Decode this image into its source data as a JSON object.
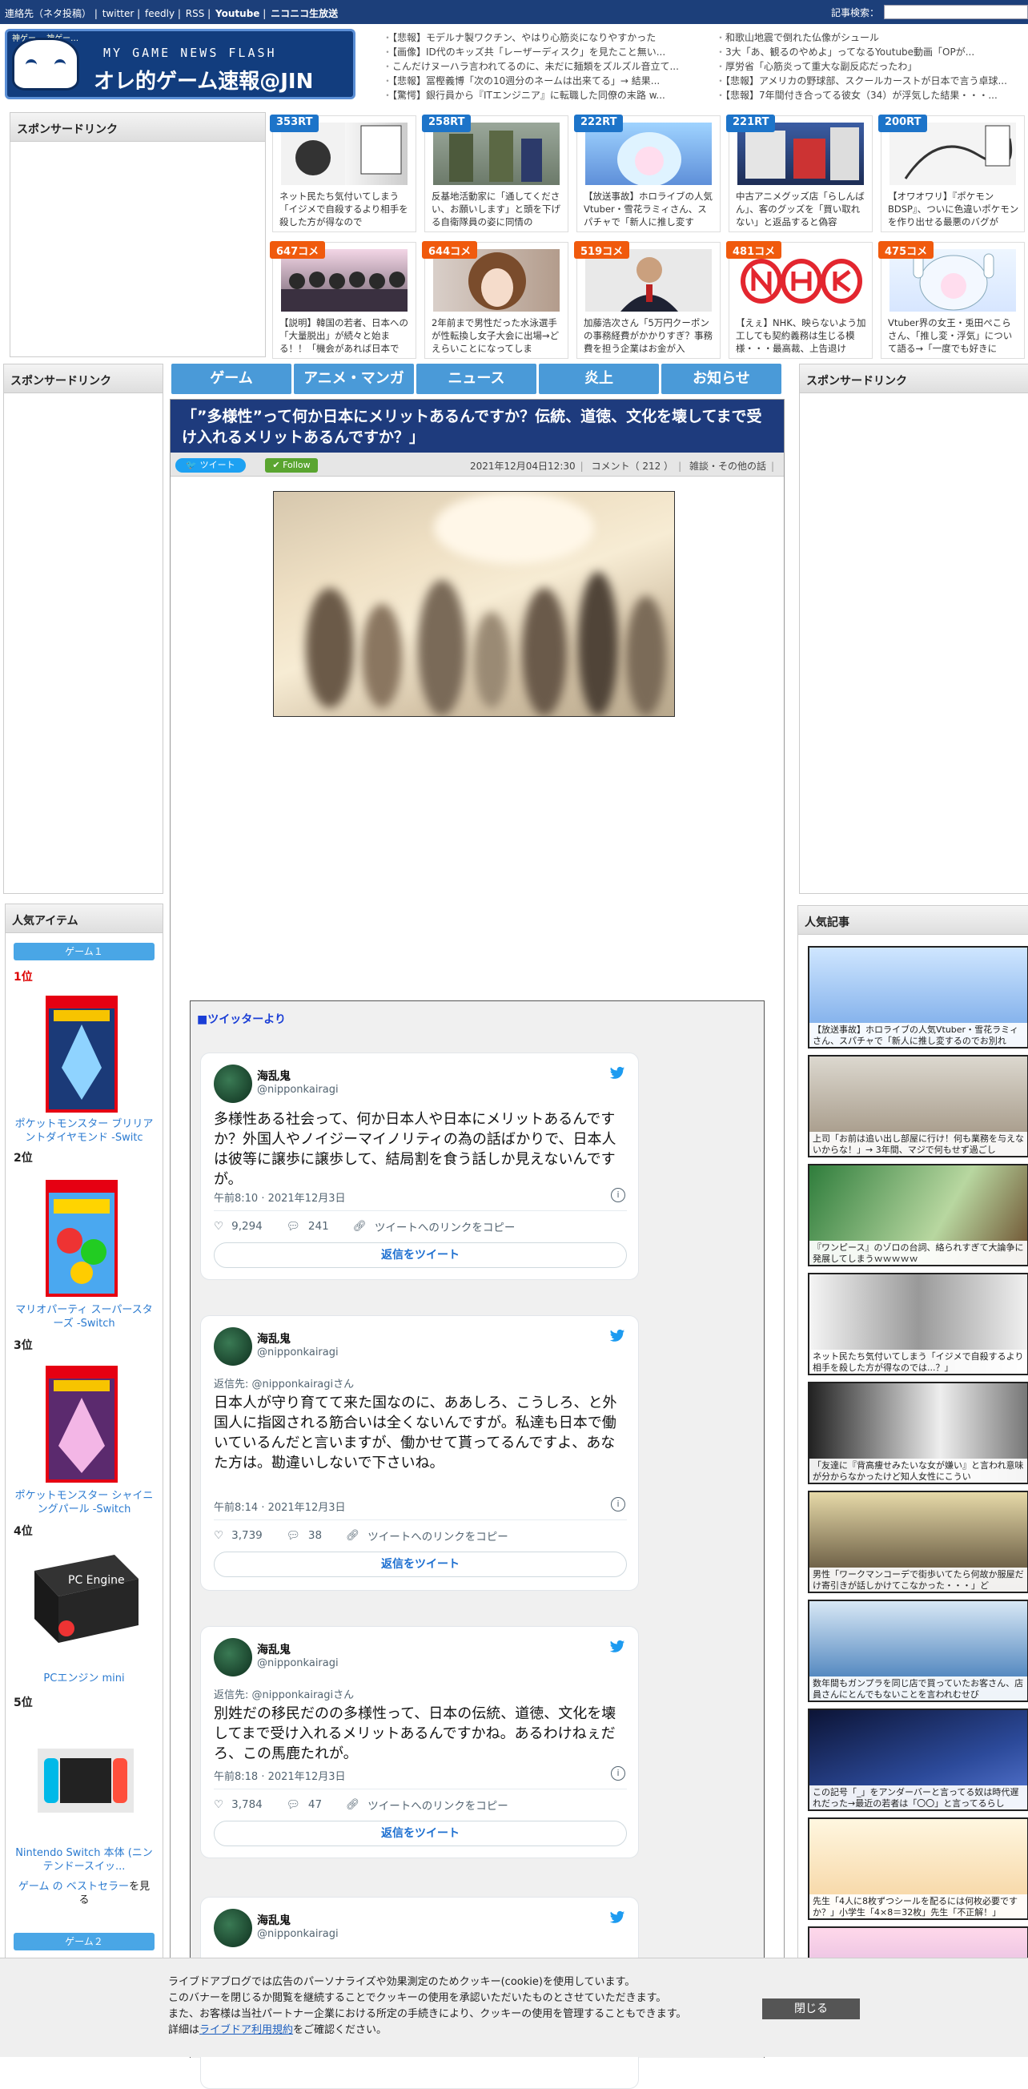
{
  "topbar": {
    "links": [
      "連絡先（ネタ投稿）",
      "twitter",
      "feedly",
      "RSS",
      "Youtube",
      "ニコニコ生放送"
    ],
    "search_label": "記事検索：",
    "search_value": ""
  },
  "logo": {
    "caption": "神ゲー… 神ゲー…",
    "sub": "MY GAME NEWS FLASH",
    "main": "オレ的ゲーム速報@JIN"
  },
  "headlines_left": [
    "【悲報】モデルナ製ワクチン、やはり心筋炎になりやすかった",
    "【画像】ID代のキッズ共「レーザーディスク」を見たこと無い...",
    "こんだけヌーハラ言われてるのに、未だに麺類をズルズル音立て...",
    "【悲報】冨樫義博「次の10週分のネームは出来てる」→ 結果...",
    "【驚愕】銀行員から『ITエンジニア』に転職した同僚の末路 w..."
  ],
  "headlines_right": [
    "和歌山地震で倒れた仏像がシュール",
    "3大「あ、観るのやめよ」ってなるYoutube動画「OPが...",
    "厚労省「心筋炎って重大な副反応だったわ」",
    "【悲報】アメリカの野球部、スクールカーストが日本で言う卓球...",
    "【悲報】7年間付き合ってる彼女（34）が浮気した結果・・・..."
  ],
  "sponsor_label": "スポンサードリンク",
  "trending": [
    {
      "badge": "353RT",
      "kind": "rt",
      "text": "ネット民たち気付いてしまう「イジメで自殺するより相手を殺した方が得なので"
    },
    {
      "badge": "258RT",
      "kind": "rt",
      "text": "反基地活動家に「通してください、お願いします」と頭を下げる自衛隊員の姿に同情の"
    },
    {
      "badge": "222RT",
      "kind": "rt",
      "text": "【放送事故】ホロライブの人気Vtuber・雪花ラミィさん、スパチャで「新人に推し変す"
    },
    {
      "badge": "221RT",
      "kind": "rt",
      "text": "中古アニメグッズ店「らしんばん」、客のグッズを「買い取れない」と返品すると偽容"
    },
    {
      "badge": "200RT",
      "kind": "rt",
      "text": "【オワオワリ】『ポケモンBDSP』、ついに色違いポケモンを作り出せる最悪のバグが"
    },
    {
      "badge": "647コメ",
      "kind": "co",
      "text": "【説明】韓国の若者、日本への「大量脱出」が続々と始まる！！「機会があれば日本で"
    },
    {
      "badge": "644コメ",
      "kind": "co",
      "text": "2年前まで男性だった水泳選手が性転換し女子大会に出場→どえらいことになってしま"
    },
    {
      "badge": "519コメ",
      "kind": "co",
      "text": "加藤浩次さん「5万円クーポンの事務経費がかかりすぎ？事務費を担う企業はお金が入"
    },
    {
      "badge": "481コメ",
      "kind": "co",
      "text": "【えぇ】NHK、映らないよう加工しても契約義務は生じる模様・・・最高裁、上告退け"
    },
    {
      "badge": "475コメ",
      "kind": "co",
      "text": "Vtuber界の女王・兎田ぺこらさん、「推し変・浮気」について語る→「一度でも好きに"
    }
  ],
  "nav": [
    "ゲーム",
    "アニメ・マンガ",
    "ニュース",
    "炎上",
    "お知らせ"
  ],
  "article": {
    "title": "「”多様性”って何か日本にメリットあるんですか？伝統、道徳、文化を壊してまで受け入れるメリットあるんですか？」",
    "tweet_btn": "ツイート",
    "follow_btn": "Follow",
    "date": "2021年12月04日12:30",
    "comments": "コメント（ 212 ）",
    "category": "雑談・その他の話"
  },
  "twitter": {
    "header": "■ツイッターより",
    "tweets": [
      {
        "name": "海乱鬼",
        "handle": "@nipponkairagi",
        "reply_to": "",
        "body": "多様性ある社会って、何か日本人や日本にメリットあるんですか？外国人やノイジーマイノリティの為の話ばかりで、日本人は彼等に譲歩に譲歩して、結局割を食う話しか見えないんですが。",
        "time": "午前8:10 · 2021年12月3日",
        "likes": "9,294",
        "replies": "241",
        "copy": "ツイートへのリンクをコピー",
        "reply_btn": "返信をツイート"
      },
      {
        "name": "海乱鬼",
        "handle": "@nipponkairagi",
        "reply_to": "返信先: @nipponkairagiさん",
        "body": "日本人が守り育てて来た国なのに、ああしろ、こうしろ、と外国人に指図される筋合いは全くないんですが。私達も日本で働いているんだと言いますが、働かせて貰ってるんですよ、あなた方は。勘違いしないで下さいね。",
        "time": "午前8:14 · 2021年12月3日",
        "likes": "3,739",
        "replies": "38",
        "copy": "ツイートへのリンクをコピー",
        "reply_btn": "返信をツイート"
      },
      {
        "name": "海乱鬼",
        "handle": "@nipponkairagi",
        "reply_to": "返信先: @nipponkairagiさん",
        "body": "別姓だの移民だのの多様性って、日本の伝統、道徳、文化を壊してまで受け入れるメリットあるんですかね。あるわけねぇだろ、この馬鹿たれが。",
        "time": "午前8:18 · 2021年12月3日",
        "likes": "3,784",
        "replies": "47",
        "copy": "ツイートへのリンクをコピー",
        "reply_btn": "返信をツイート"
      },
      {
        "name": "海乱鬼",
        "handle": "@nipponkairagi"
      }
    ]
  },
  "popular_items": {
    "header": "人気アイテム",
    "cat1": "ゲーム１",
    "cat2": "ゲーム２",
    "ranks": [
      "1位",
      "2位",
      "3位",
      "4位",
      "5位"
    ],
    "names": [
      "ポケットモンスター ブリリアントダイヤモンド -Switc",
      "マリオパーティ スーパースターズ -Switch",
      "ポケットモンスター シャイニングパール -Switch",
      "PCエンジン mini",
      "Nintendo Switch 本体 (ニンテンドースイッ..."
    ],
    "bestseller_link": "ゲーム の ベストセラー",
    "bestseller_suffix": "を見る"
  },
  "popular_articles": {
    "header": "人気記事",
    "items": [
      "【放送事故】ホロライブの人気Vtuber・雪花ラミィさん、スパチャで「新人に推し変するのでお別れ",
      "上司「お前は追い出し部屋に行け！何も業務を与えないからな！」→ 3年間、マジで何もせず過ごし",
      "『ワンピース』のゾロの台詞、絡られすぎて大論争に発展してしまうｗｗｗｗｗ",
      "ネット民たち気付いてしまう「イジメで自殺するより相手を殺した方が得なのでは...？」",
      "「友達に『背高痩せみたいな女が嫌い』と言われ意味が分からなかったけど知人女性にこうい",
      "男性「ワークマンコーデで街歩いてたら何故か服屋だけ寄引きが話しかけてこなかった・・・」ど",
      "数年間もガンプラを同じ店で買っていたお客さん、店員さんにとんでもないことを言われむせび",
      "この記号「_」をアンダーバーと言ってる奴は時代遅れだった→最近の若者は「〇〇」と言ってるらし",
      "先生「4人に8枚ずつシールを配るには何枚必要ですか？」小学生「4×8＝32枚」先生「不正解！」"
    ]
  },
  "cookie": {
    "lines": [
      "ライブドアブログでは広告のパーソナライズや効果測定のためクッキー(cookie)を使用しています。",
      "このバナーを閉じるか閲覧を継続することでクッキーの使用を承認いただいたものとさせていただきます。",
      "また、お客様は当社パートナー企業における所定の手続きにより、クッキーの使用を管理することもできます。"
    ],
    "detail_prefix": "詳細は",
    "detail_link": "ライブドア利用規約",
    "detail_suffix": "をご確認ください。",
    "close": "閉じる"
  }
}
